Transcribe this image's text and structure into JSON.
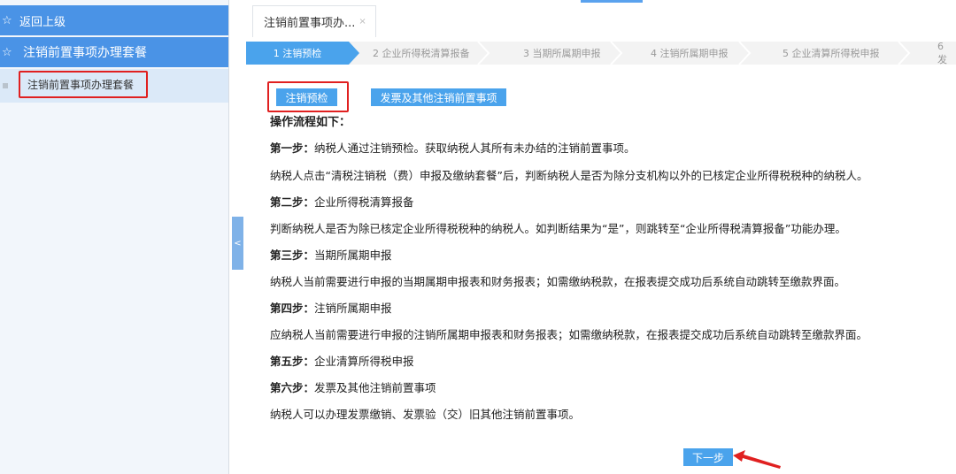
{
  "sidebar": {
    "back_label": "返回上级",
    "package_label": "注销前置事项办理套餐",
    "selected_label": "注销前置事项办理套餐"
  },
  "tab": {
    "title": "注销前置事项办...",
    "close": "×"
  },
  "steps": [
    "1 注销预检",
    "2 企业所得税清算报备",
    "3 当期所属期申报",
    "4 注销所属期申报",
    "5 企业清算所得税申报",
    "6 发"
  ],
  "buttons": {
    "precheck": "注销预检",
    "invoice": "发票及其他注销前置事项",
    "next": "下一步"
  },
  "content": {
    "heading": "操作流程如下：",
    "s1_title": "第一步：",
    "s1_text": "纳税人通过注销预检。获取纳税人其所有未办结的注销前置事项。",
    "p1": "纳税人点击“清税注销税（费）申报及缴纳套餐”后，判断纳税人是否为除分支机构以外的已核定企业所得税税种的纳税人。",
    "s2_title": "第二步：",
    "s2_text": "企业所得税清算报备",
    "p2": "判断纳税人是否为除已核定企业所得税税种的纳税人。如判断结果为“是”，则跳转至“企业所得税清算报备”功能办理。",
    "s3_title": "第三步：",
    "s3_text": "当期所属期申报",
    "p3": "纳税人当前需要进行申报的当期属期申报表和财务报表；如需缴纳税款，在报表提交成功后系统自动跳转至缴款界面。",
    "s4_title": "第四步：",
    "s4_text": "注销所属期申报",
    "p4": "应纳税人当前需要进行申报的注销所属期申报表和财务报表；如需缴纳税款，在报表提交成功后系统自动跳转至缴款界面。",
    "s5_title": "第五步：",
    "s5_text": "企业清算所得税申报",
    "s6_title": "第六步：",
    "s6_text": "发票及其他注销前置事项",
    "p6": "纳税人可以办理发票缴销、发票验（交）旧其他注销前置事项。"
  },
  "colors": {
    "accent": "#4aa3ec",
    "sidebar_header": "#4a93e6",
    "highlight": "#e02020"
  }
}
